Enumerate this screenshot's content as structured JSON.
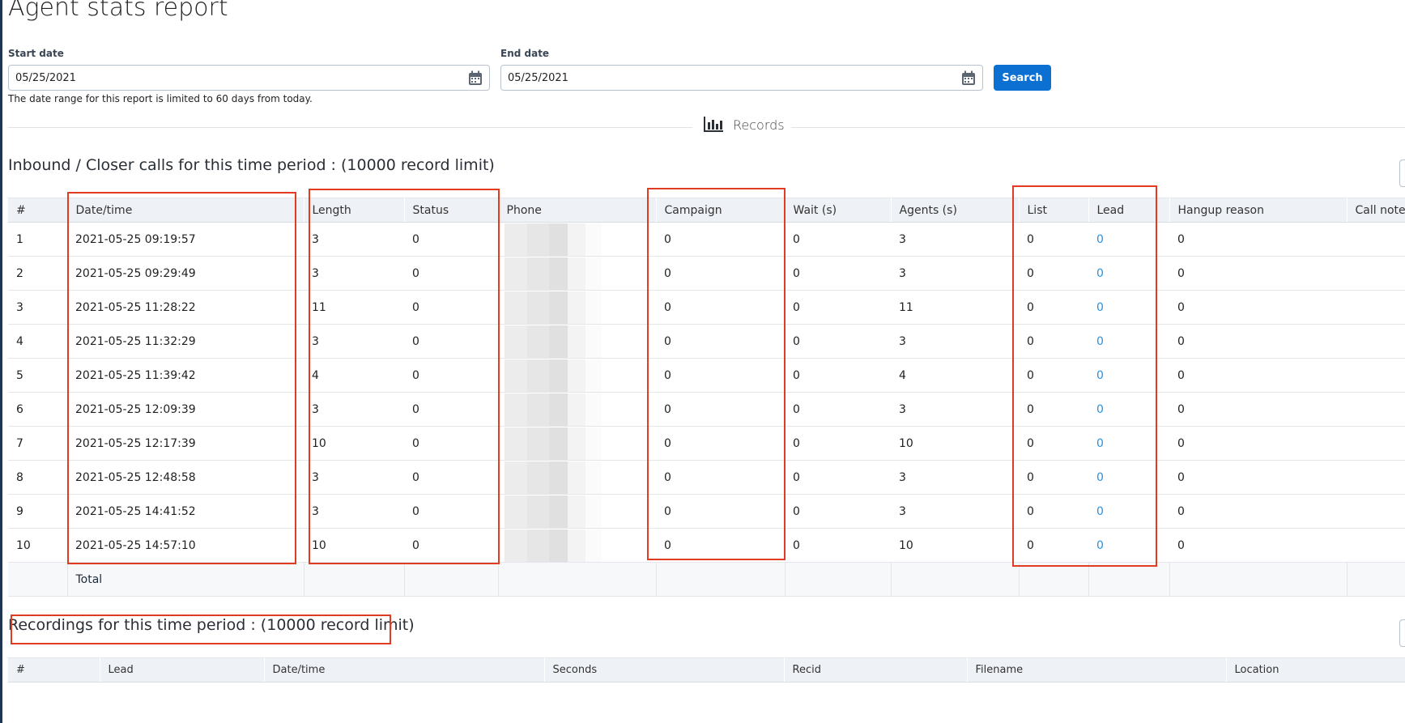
{
  "page": {
    "title": "Agent stats report"
  },
  "filters": {
    "start_label": "Start date",
    "start_value": "05/25/2021",
    "end_label": "End date",
    "end_value": "05/25/2021",
    "search_label": "Search",
    "help_text": "The date range for this report is limited to 60 days from today."
  },
  "records_tab": {
    "label": "Records",
    "icon": "bar-chart-icon"
  },
  "inbound": {
    "title": "Inbound / Closer calls for this time period : (10000 record limit)",
    "columns": [
      "#",
      "Date/time",
      "Length",
      "Status",
      "Phone",
      "Campaign",
      "Wait (s)",
      "Agents (s)",
      "List",
      "Lead",
      "Hangup reason",
      "Call notes"
    ],
    "rows": [
      [
        "1",
        "2021-05-25 09:19:57",
        "3",
        "0",
        "",
        "0",
        "0",
        "3",
        "0",
        "0",
        "0",
        ""
      ],
      [
        "2",
        "2021-05-25 09:29:49",
        "3",
        "0",
        "",
        "0",
        "0",
        "3",
        "0",
        "0",
        "0",
        ""
      ],
      [
        "3",
        "2021-05-25 11:28:22",
        "11",
        "0",
        "",
        "0",
        "0",
        "11",
        "0",
        "0",
        "0",
        ""
      ],
      [
        "4",
        "2021-05-25 11:32:29",
        "3",
        "0",
        "",
        "0",
        "0",
        "3",
        "0",
        "0",
        "0",
        ""
      ],
      [
        "5",
        "2021-05-25 11:39:42",
        "4",
        "0",
        "",
        "0",
        "0",
        "4",
        "0",
        "0",
        "0",
        ""
      ],
      [
        "6",
        "2021-05-25 12:09:39",
        "3",
        "0",
        "",
        "0",
        "0",
        "3",
        "0",
        "0",
        "0",
        ""
      ],
      [
        "7",
        "2021-05-25 12:17:39",
        "10",
        "0",
        "",
        "0",
        "0",
        "10",
        "0",
        "0",
        "0",
        ""
      ],
      [
        "8",
        "2021-05-25 12:48:58",
        "3",
        "0",
        "",
        "0",
        "0",
        "3",
        "0",
        "0",
        "0",
        ""
      ],
      [
        "9",
        "2021-05-25 14:41:52",
        "3",
        "0",
        "",
        "0",
        "0",
        "3",
        "0",
        "0",
        "0",
        ""
      ],
      [
        "10",
        "2021-05-25 14:57:10",
        "10",
        "0",
        "",
        "0",
        "0",
        "10",
        "0",
        "0",
        "0",
        ""
      ]
    ],
    "total_label": "Total"
  },
  "recordings": {
    "title": "Recordings for this time period : (10000 record limit)",
    "columns": [
      "#",
      "Lead",
      "Date/time",
      "Seconds",
      "Recid",
      "Filename",
      "Location"
    ]
  },
  "colors": {
    "accent": "#0b70d1",
    "link": "#2d8fd6",
    "highlight": "#e13b22",
    "header_bg": "#eef1f5"
  }
}
